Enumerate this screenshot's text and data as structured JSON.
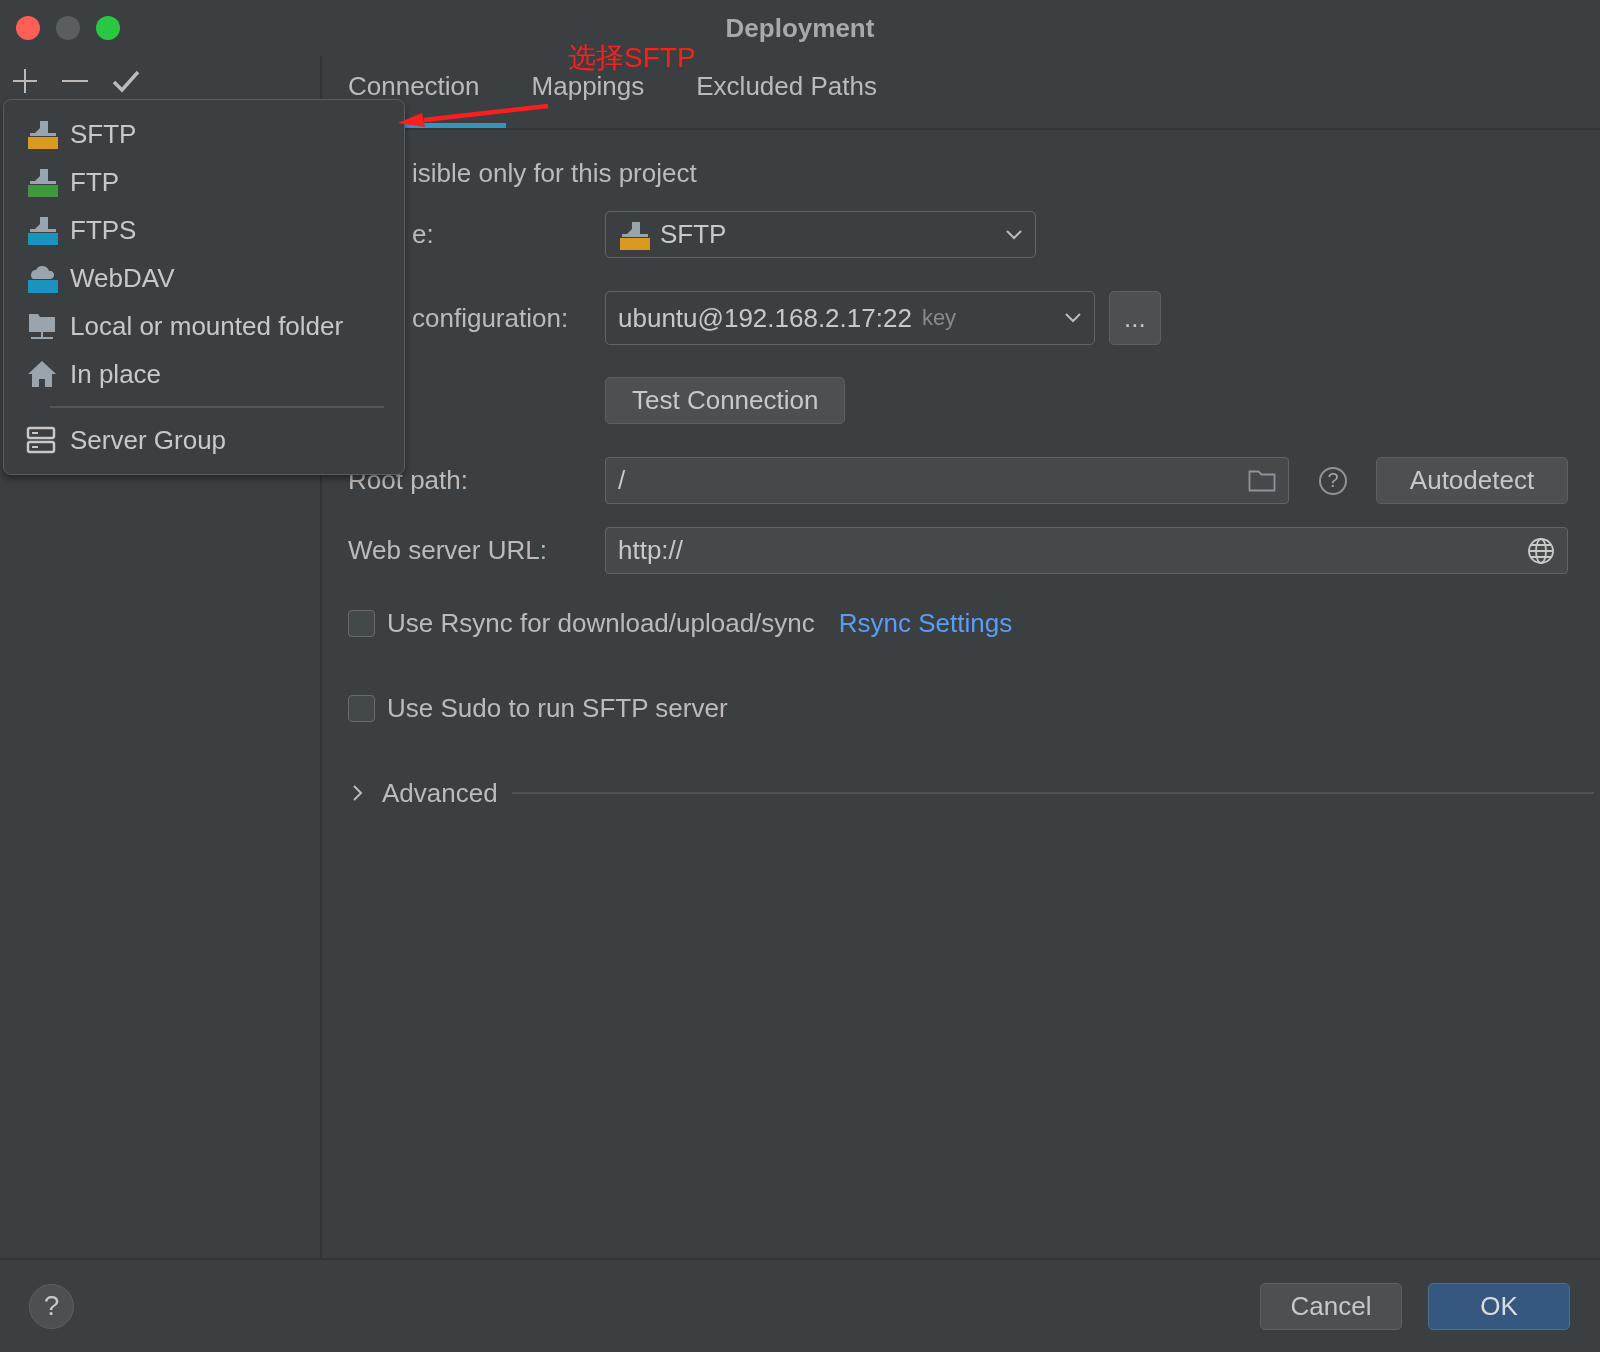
{
  "window": {
    "title": "Deployment"
  },
  "annotation": {
    "text": "选择SFTP"
  },
  "add_menu": {
    "sections": [
      [
        {
          "kind": "sftp",
          "label": "SFTP"
        },
        {
          "kind": "ftp",
          "label": "FTP"
        },
        {
          "kind": "ftps",
          "label": "FTPS"
        },
        {
          "kind": "webdav",
          "label": "WebDAV"
        },
        {
          "kind": "folder",
          "label": "Local or mounted folder"
        },
        {
          "kind": "inplace",
          "label": "In place"
        }
      ],
      [
        {
          "kind": "group",
          "label": "Server Group"
        }
      ]
    ]
  },
  "tabs": [
    {
      "label": "Connection",
      "selected": true
    },
    {
      "label": "Mappings",
      "selected": false
    },
    {
      "label": "Excluded Paths",
      "selected": false
    }
  ],
  "connection": {
    "visible_only": {
      "label": "isible only for this project"
    },
    "type": {
      "label": "e:",
      "value": "SFTP",
      "kind": "sftp"
    },
    "ssh": {
      "label": "configuration:",
      "value": "ubuntu@192.168.2.17:22",
      "hint": "key",
      "more": "..."
    },
    "test_button": "Test Connection",
    "root_path": {
      "label": "Root path:",
      "value": "/",
      "help": "?",
      "autodetect": "Autodetect"
    },
    "web_url": {
      "label": "Web server URL:",
      "value": "http://"
    },
    "options": [
      {
        "label": "Use Rsync for download/upload/sync",
        "checked": false,
        "link": "Rsync Settings"
      },
      {
        "label": "Use Sudo to run SFTP server",
        "checked": false
      }
    ],
    "advanced": {
      "label": "Advanced",
      "expanded": false
    }
  },
  "footer": {
    "help": "?",
    "buttons": [
      {
        "label": "Cancel",
        "primary": false
      },
      {
        "label": "OK",
        "primary": true
      }
    ]
  }
}
